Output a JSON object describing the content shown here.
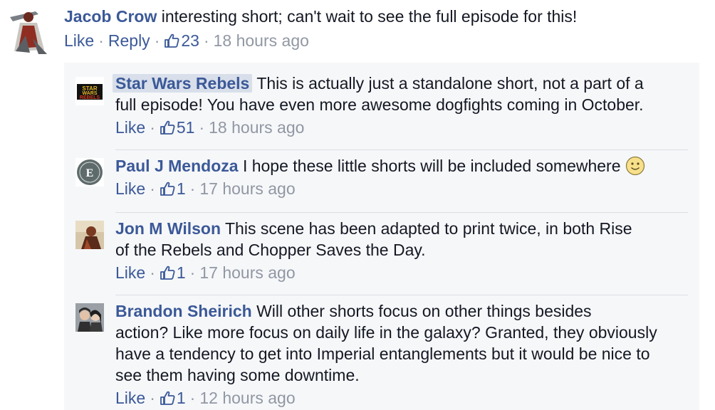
{
  "top_comment": {
    "author": "Jacob Crow",
    "text": "interesting short; can't wait to see the full episode for this!",
    "actions": {
      "like": "Like",
      "reply": "Reply",
      "likes_count": "23",
      "time": "18 hours ago"
    },
    "avatar_icon": "samurai-avatar-icon"
  },
  "replies": [
    {
      "author": "Star Wars Rebels",
      "lines": [
        "This is actually just a standalone short, not a part of a",
        "full episode! You have even more awesome dogfights coming in October."
      ],
      "actions": {
        "like": "Like",
        "likes_count": "51",
        "time": "18 hours ago"
      },
      "avatar_icon": "star-wars-rebels-logo-icon"
    },
    {
      "author": "Paul J Mendoza",
      "lines": [
        "I hope these little shorts will be included somewhere"
      ],
      "actions": {
        "like": "Like",
        "likes_count": "1",
        "time": "17 hours ago"
      },
      "avatar_icon": "emblem-avatar-icon",
      "emoji": "smiley-emoji-icon"
    },
    {
      "author": "Jon M Wilson",
      "lines": [
        "This scene has been adapted to print twice, in both Rise",
        "of the Rebels and Chopper Saves the Day."
      ],
      "actions": {
        "like": "Like",
        "likes_count": "1",
        "time": "17 hours ago"
      },
      "avatar_icon": "portrait-avatar-icon"
    },
    {
      "author": "Brandon Sheirich",
      "lines": [
        "Will other shorts focus on other things besides",
        "action? Like more focus on daily life in the galaxy? Granted, they obviously",
        "have a tendency to get into Imperial entanglements but it would be nice to",
        "see them having some downtime."
      ],
      "actions": {
        "like": "Like",
        "likes_count": "1",
        "time": "12 hours ago"
      },
      "avatar_icon": "couple-photo-avatar-icon"
    }
  ],
  "colors": {
    "link": "#3b5998",
    "meta": "#9197a3",
    "panel": "#f6f7f9",
    "divider": "#dcdee3"
  }
}
